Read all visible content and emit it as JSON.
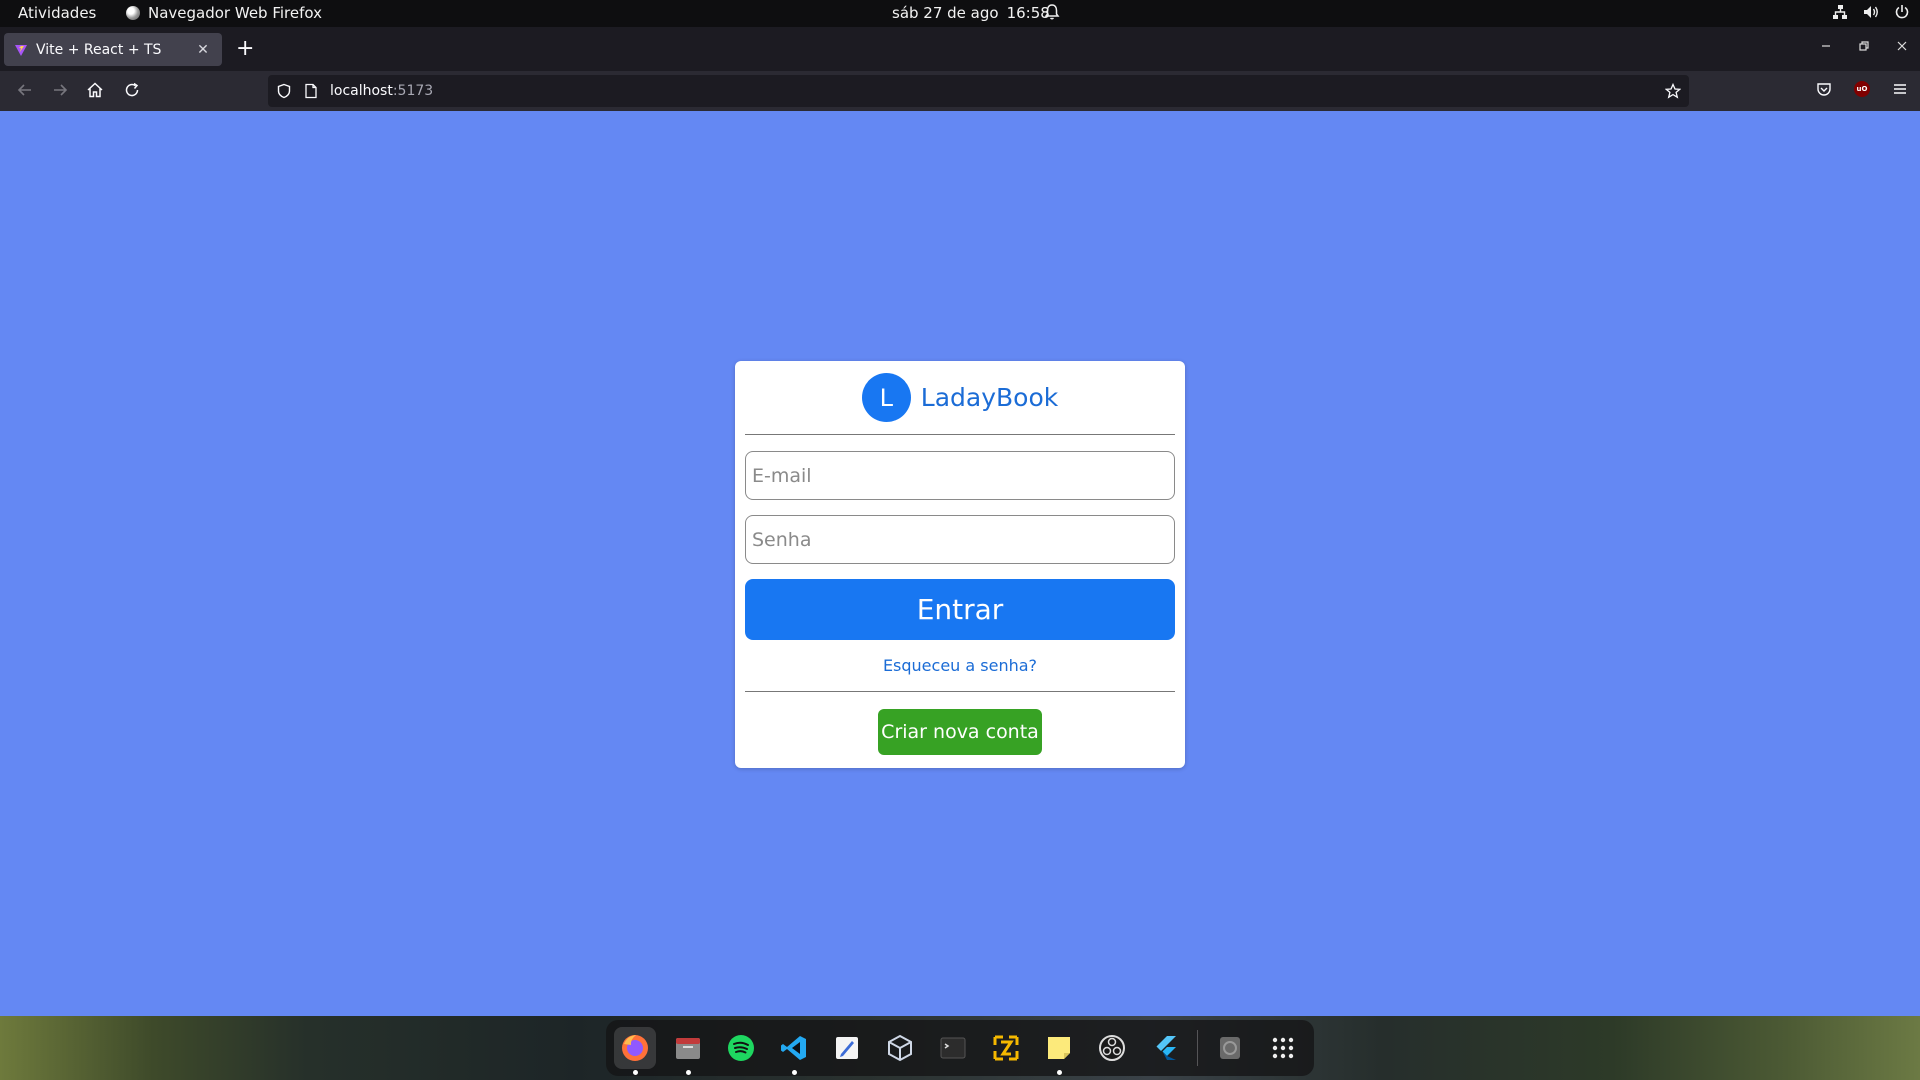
{
  "topbar": {
    "activities": "Atividades",
    "app_name": "Navegador Web Firefox",
    "date": "sáb 27 de ago",
    "time": "16:58"
  },
  "browser": {
    "tab_title": "Vite + React + TS",
    "url_host": "localhost",
    "url_port": ":5173"
  },
  "login": {
    "logo_letter": "L",
    "brand_name": "LadayBook",
    "email_placeholder": "E-mail",
    "password_placeholder": "Senha",
    "login_button": "Entrar",
    "forgot_link": "Esqueceu a senha?",
    "create_account_button": "Criar nova conta"
  },
  "colors": {
    "page_background": "#6488f3",
    "primary_blue": "#1877f2",
    "brand_text": "#1b6cd6",
    "create_green": "#37a224"
  },
  "dock": {
    "apps": [
      "firefox-icon",
      "files-icon",
      "spotify-icon",
      "vscode-icon",
      "text-editor-icon",
      "virtualbox-icon",
      "terminal-icon",
      "filezilla-icon",
      "sticky-notes-icon",
      "obs-icon",
      "flutter-icon",
      "disk-icon",
      "app-grid-icon"
    ]
  }
}
